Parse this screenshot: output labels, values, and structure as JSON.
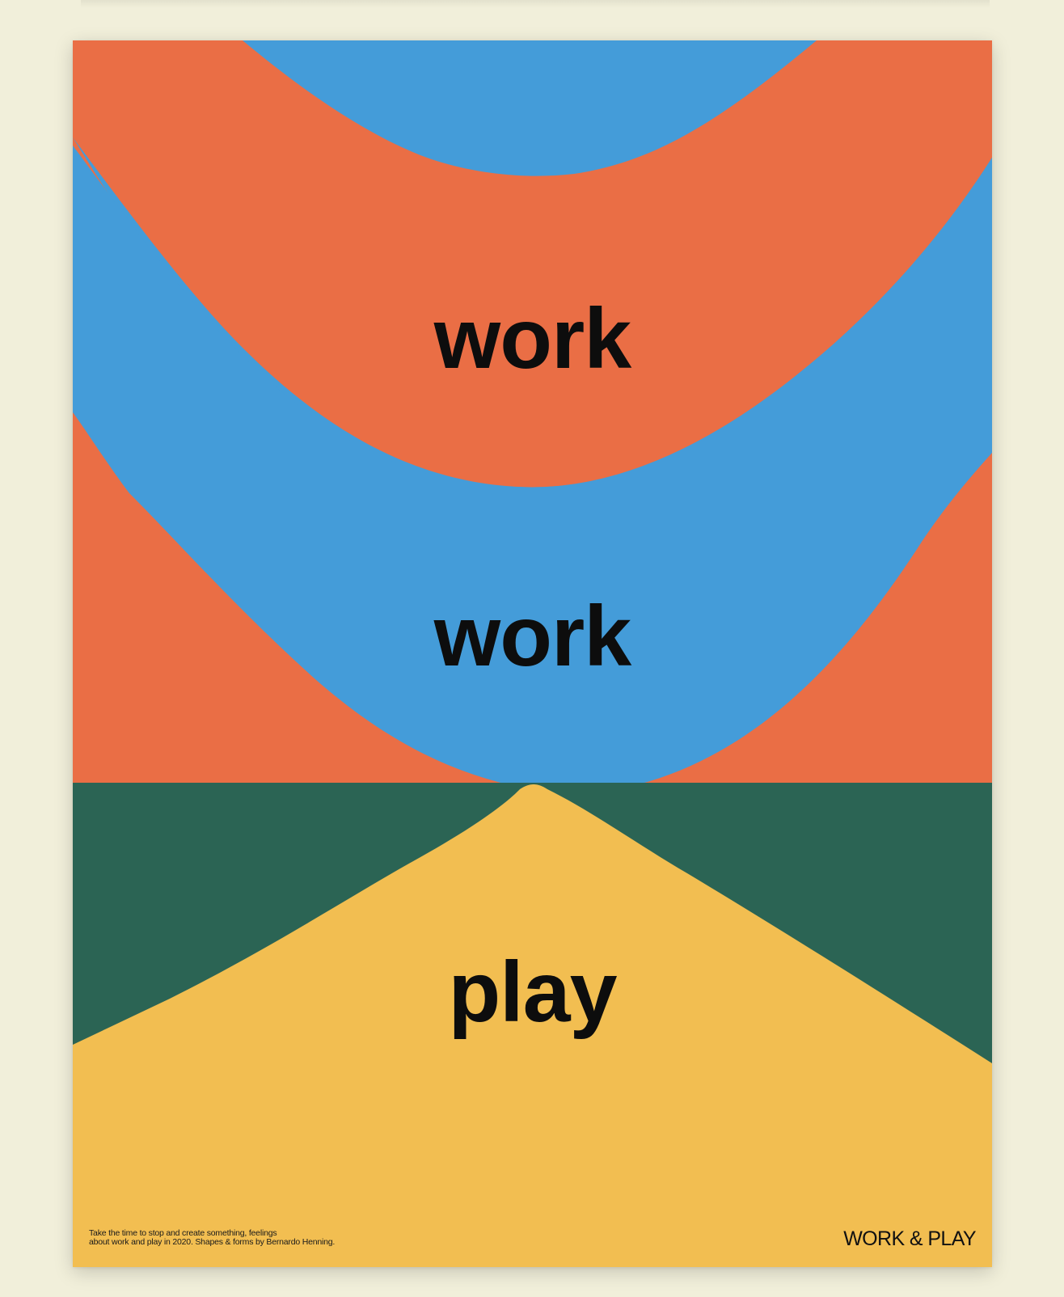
{
  "poster": {
    "words": [
      "work",
      "work",
      "play"
    ],
    "caption_lines": [
      "Take the time to stop and create something, feelings",
      "about work and play in 2020. Shapes & forms by Bernardo Henning."
    ],
    "brand": "WORK & PLAY"
  },
  "colors": {
    "page_background": "#f1efda",
    "orange": "#ea6e45",
    "blue": "#449cd9",
    "green": "#2b6454",
    "yellow": "#f2be51",
    "text": "#0d0d0d"
  }
}
